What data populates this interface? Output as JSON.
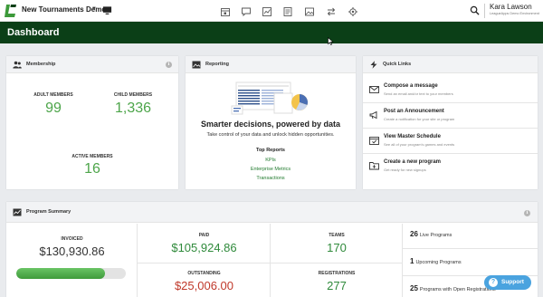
{
  "topbar": {
    "org_name": "New Tournaments Demo",
    "nav_icons": [
      "calendar-icon",
      "chat-icon",
      "chart-icon",
      "document-icon",
      "image-icon",
      "transfer-icon",
      "settings-icon"
    ],
    "user_name": "Kara Lawson",
    "user_env": "LeagueApps Demo Environment"
  },
  "header": {
    "title": "Dashboard"
  },
  "membership": {
    "title": "Membership",
    "adult_label": "ADULT MEMBERS",
    "adult_value": "99",
    "child_label": "CHILD MEMBERS",
    "child_value": "1,336",
    "active_label": "ACTIVE MEMBERS",
    "active_value": "16"
  },
  "reporting": {
    "title": "Reporting",
    "headline": "Smarter decisions, powered by data",
    "subtext": "Take control of your data and unlock hidden opportunities.",
    "top_reports_label": "Top Reports",
    "links": [
      "KPIs",
      "Enterprise Metrics",
      "Transactions"
    ]
  },
  "quick_links": {
    "title": "Quick Links",
    "items": [
      {
        "title": "Compose a message",
        "sub": "Send an email and/or text to your members"
      },
      {
        "title": "Post an Announcement",
        "sub": "Create a notification for your site or program"
      },
      {
        "title": "View Master Schedule",
        "sub": "See all of your program's games and events"
      },
      {
        "title": "Create a new program",
        "sub": "Get ready for new signups"
      }
    ]
  },
  "program_summary": {
    "title": "Program Summary",
    "invoiced_label": "INVOICED",
    "invoiced_value": "$130,930.86",
    "progress": 0.81,
    "paid_label": "PAID",
    "paid_value": "$105,924.86",
    "outstanding_label": "OUTSTANDING",
    "outstanding_value": "$25,006.00",
    "teams_label": "TEAMS",
    "teams_value": "170",
    "registrations_label": "REGISTRATIONS",
    "registrations_value": "277",
    "live_count": "26",
    "live_label": "Live Programs",
    "upcoming_count": "1",
    "upcoming_label": "Upcoming Programs",
    "open_count": "25",
    "open_label": "Programs with Open Registrations"
  },
  "support": {
    "label": "Support"
  },
  "colors": {
    "brand_green": "#0b3f17",
    "value_green": "#4da54a",
    "money_green": "#2f8a3b",
    "money_red": "#c0392b",
    "support_blue": "#4aa3df"
  }
}
